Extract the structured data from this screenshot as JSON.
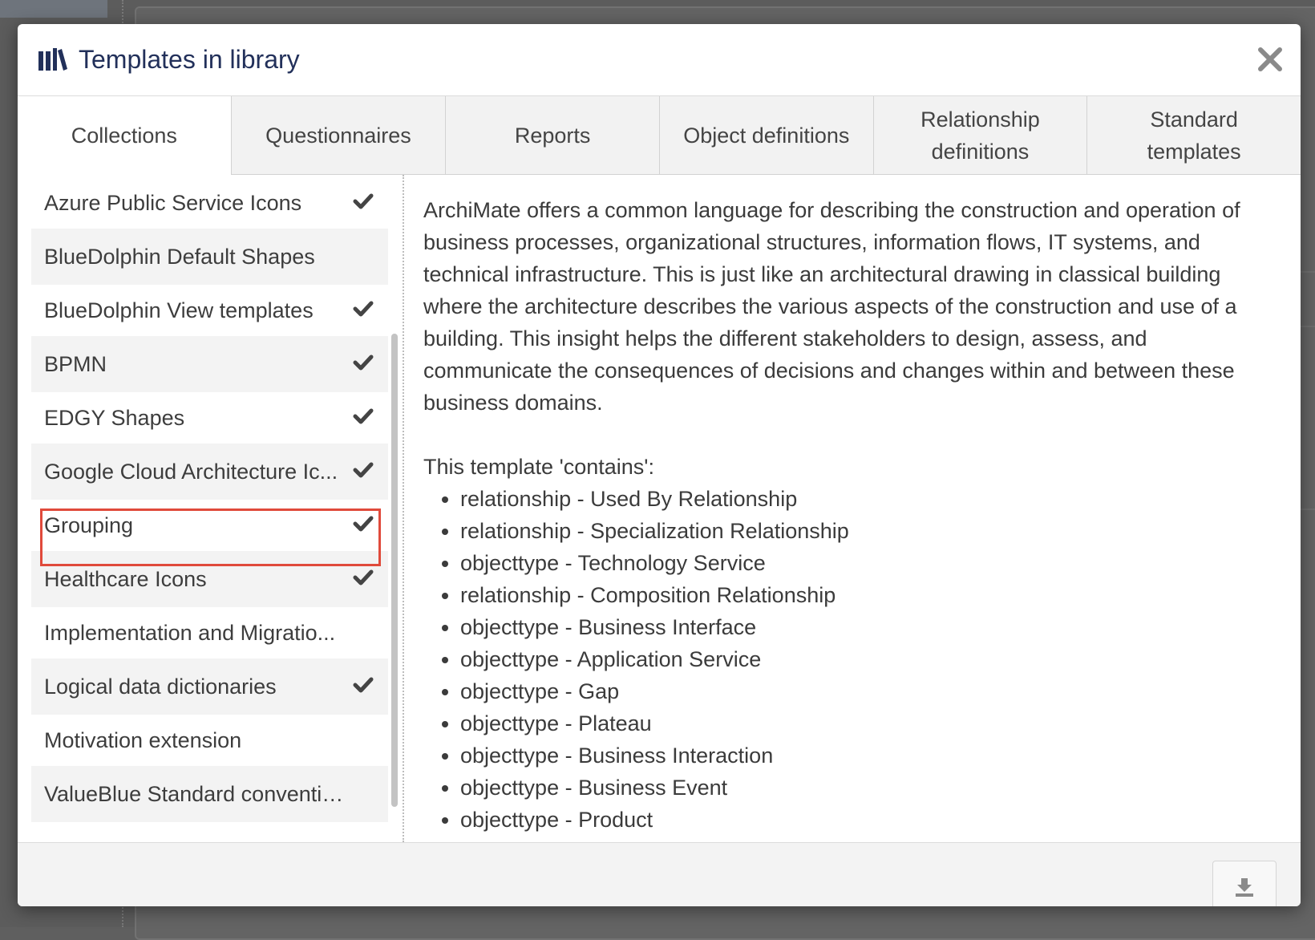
{
  "modal": {
    "title": "Templates in library"
  },
  "tabs": [
    {
      "label": "Collections",
      "active": true
    },
    {
      "label": "Questionnaires",
      "active": false
    },
    {
      "label": "Reports",
      "active": false
    },
    {
      "label": "Object definitions",
      "active": false
    },
    {
      "label": "Relationship\ndefinitions",
      "active": false
    },
    {
      "label": "Standard\ntemplates",
      "active": false
    }
  ],
  "collections": [
    {
      "label": "Azure Public Service Icons",
      "checked": true
    },
    {
      "label": "BlueDolphin Default Shapes",
      "checked": false
    },
    {
      "label": "BlueDolphin View templates",
      "checked": true
    },
    {
      "label": "BPMN",
      "checked": true
    },
    {
      "label": "EDGY Shapes",
      "checked": true
    },
    {
      "label": "Google Cloud Architecture Ic...",
      "checked": true
    },
    {
      "label": "Grouping",
      "checked": true
    },
    {
      "label": "Healthcare Icons",
      "checked": true
    },
    {
      "label": "Implementation and Migratio...",
      "checked": false
    },
    {
      "label": "Logical data dictionaries",
      "checked": true
    },
    {
      "label": "Motivation extension",
      "checked": false
    },
    {
      "label": "ValueBlue Standard convention",
      "checked": false
    }
  ],
  "detail": {
    "description": "ArchiMate offers a common language for describing the construction and operation of business processes, organizational structures, information flows, IT systems, and technical infrastructure. This is just like an architectural drawing in classical building where the architecture describes the various aspects of the construction and use of a building. This insight helps the different stakeholders to design, assess, and communicate the consequences of decisions and changes within and between these business domains.",
    "contains_heading": "This template 'contains':",
    "contains": [
      "relationship - Used By Relationship",
      "relationship - Specialization Relationship",
      "objecttype - Technology Service",
      "relationship - Composition Relationship",
      "objecttype - Business Interface",
      "objecttype - Application Service",
      "objecttype - Gap",
      "objecttype - Plateau",
      "objecttype - Business Interaction",
      "objecttype - Business Event",
      "objecttype - Product"
    ]
  },
  "colors": {
    "title": "#22305a",
    "highlight": "#e04a3b"
  },
  "icons": {
    "header": "library-icon",
    "close": "close-icon",
    "check": "check-icon",
    "download": "download-icon"
  }
}
